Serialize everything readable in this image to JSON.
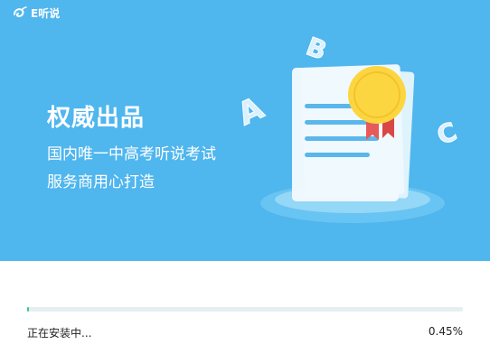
{
  "app": {
    "logo_text": "E听说"
  },
  "banner": {
    "headline": "权威出品",
    "line1": "国内唯一中高考听说考试",
    "line2": "服务商用心打造",
    "letters": [
      "A",
      "B",
      "C"
    ],
    "illustration_icon": "certificate-document-icon"
  },
  "install": {
    "status_text": "正在安装中...",
    "percent_text": "0.45%",
    "progress": 0.0045
  },
  "colors": {
    "banner_bg": "#4fb6ee",
    "progress_fill": "#35c98e",
    "progress_track": "#e6eef2",
    "medal": "#fcd640",
    "ribbon": "#e65a5a"
  }
}
